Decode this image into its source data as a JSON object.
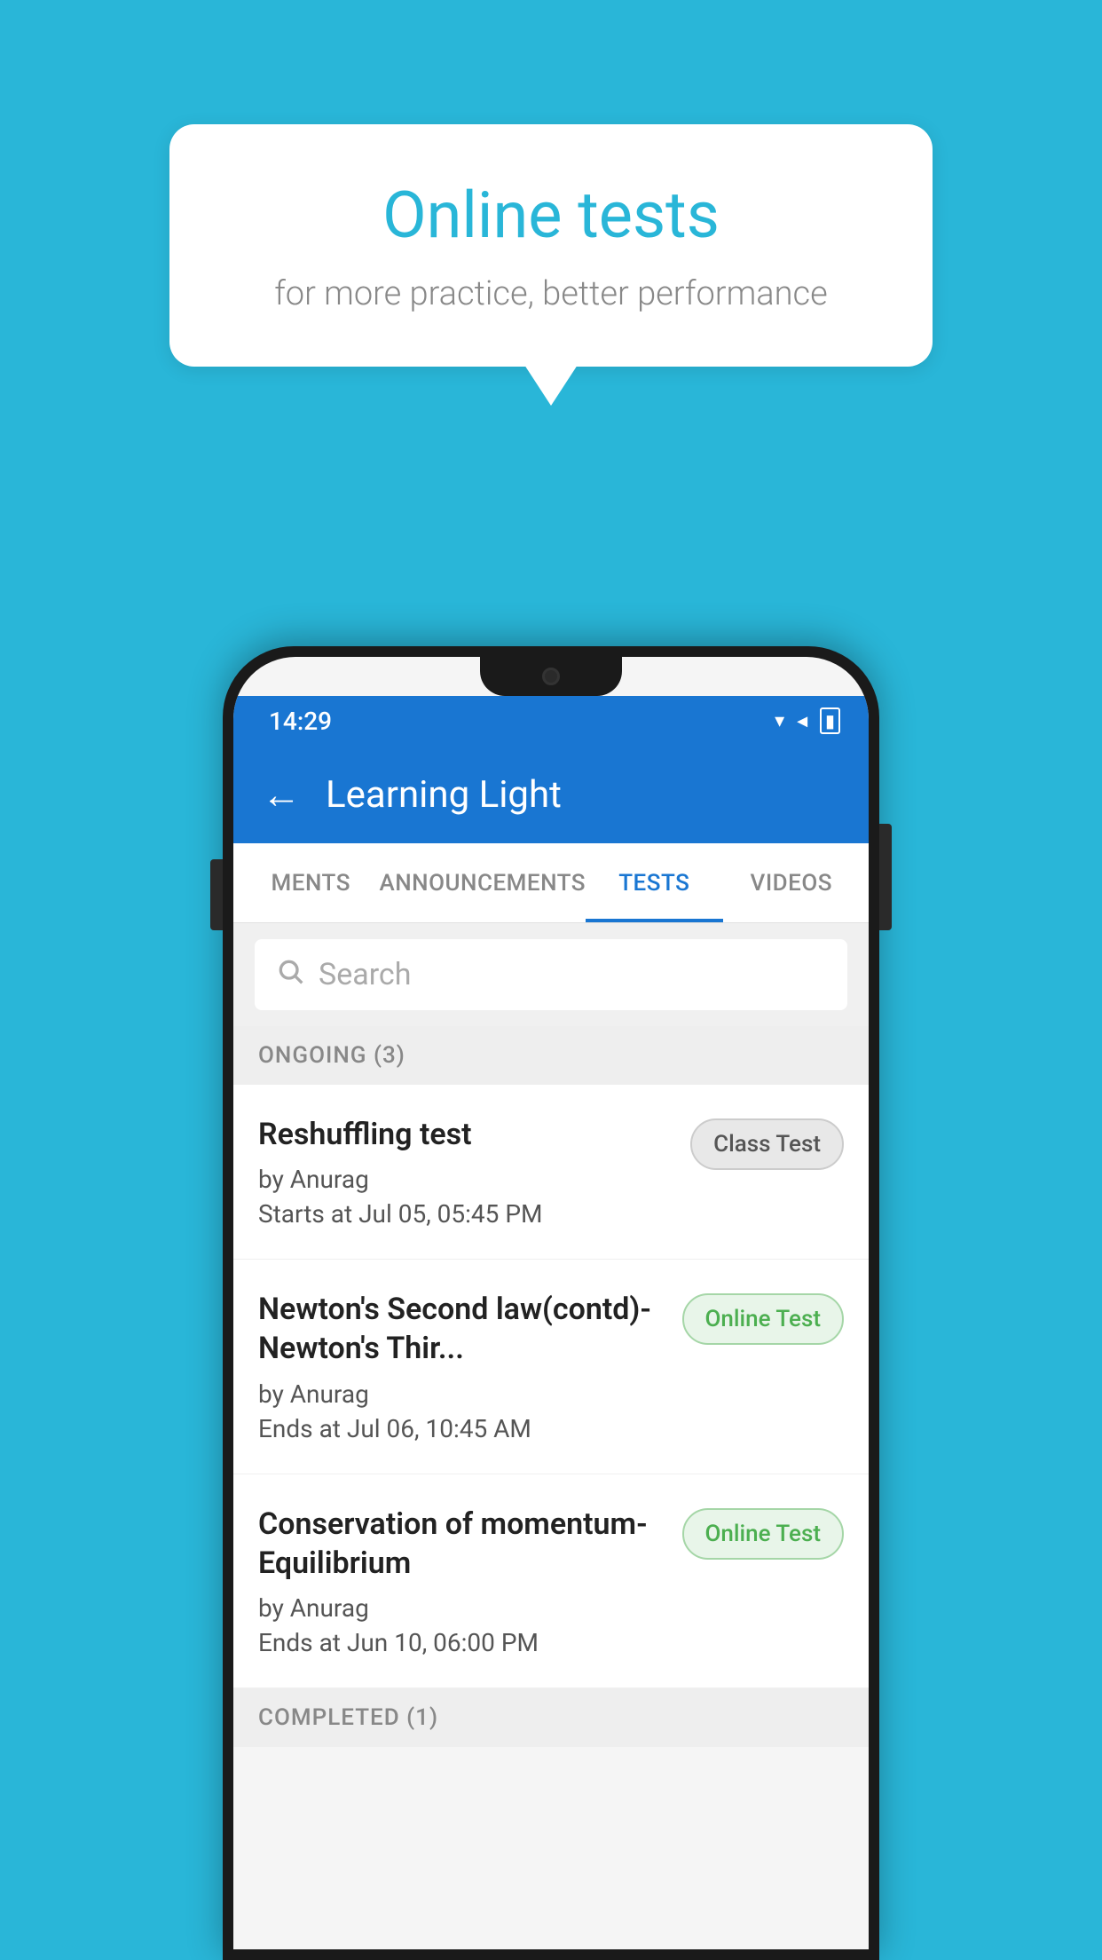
{
  "background_color": "#29b6d8",
  "bubble": {
    "title": "Online tests",
    "subtitle": "for more practice, better performance"
  },
  "phone": {
    "status_bar": {
      "time": "14:29",
      "wifi": "▼",
      "signal": "▲",
      "battery": "▮"
    },
    "header": {
      "back_label": "←",
      "title": "Learning Light"
    },
    "tabs": [
      {
        "label": "MENTS",
        "active": false
      },
      {
        "label": "ANNOUNCEMENTS",
        "active": false
      },
      {
        "label": "TESTS",
        "active": true
      },
      {
        "label": "VIDEOS",
        "active": false
      }
    ],
    "search": {
      "placeholder": "Search"
    },
    "ongoing_section": {
      "label": "ONGOING (3)"
    },
    "tests": [
      {
        "name": "Reshuffling test",
        "author": "by Anurag",
        "time_label": "Starts at",
        "time": "Jul 05, 05:45 PM",
        "badge": "Class Test",
        "badge_type": "class"
      },
      {
        "name": "Newton's Second law(contd)-Newton's Thir...",
        "author": "by Anurag",
        "time_label": "Ends at",
        "time": "Jul 06, 10:45 AM",
        "badge": "Online Test",
        "badge_type": "online"
      },
      {
        "name": "Conservation of momentum-Equilibrium",
        "author": "by Anurag",
        "time_label": "Ends at",
        "time": "Jun 10, 06:00 PM",
        "badge": "Online Test",
        "badge_type": "online"
      }
    ],
    "completed_section": {
      "label": "COMPLETED (1)"
    }
  }
}
